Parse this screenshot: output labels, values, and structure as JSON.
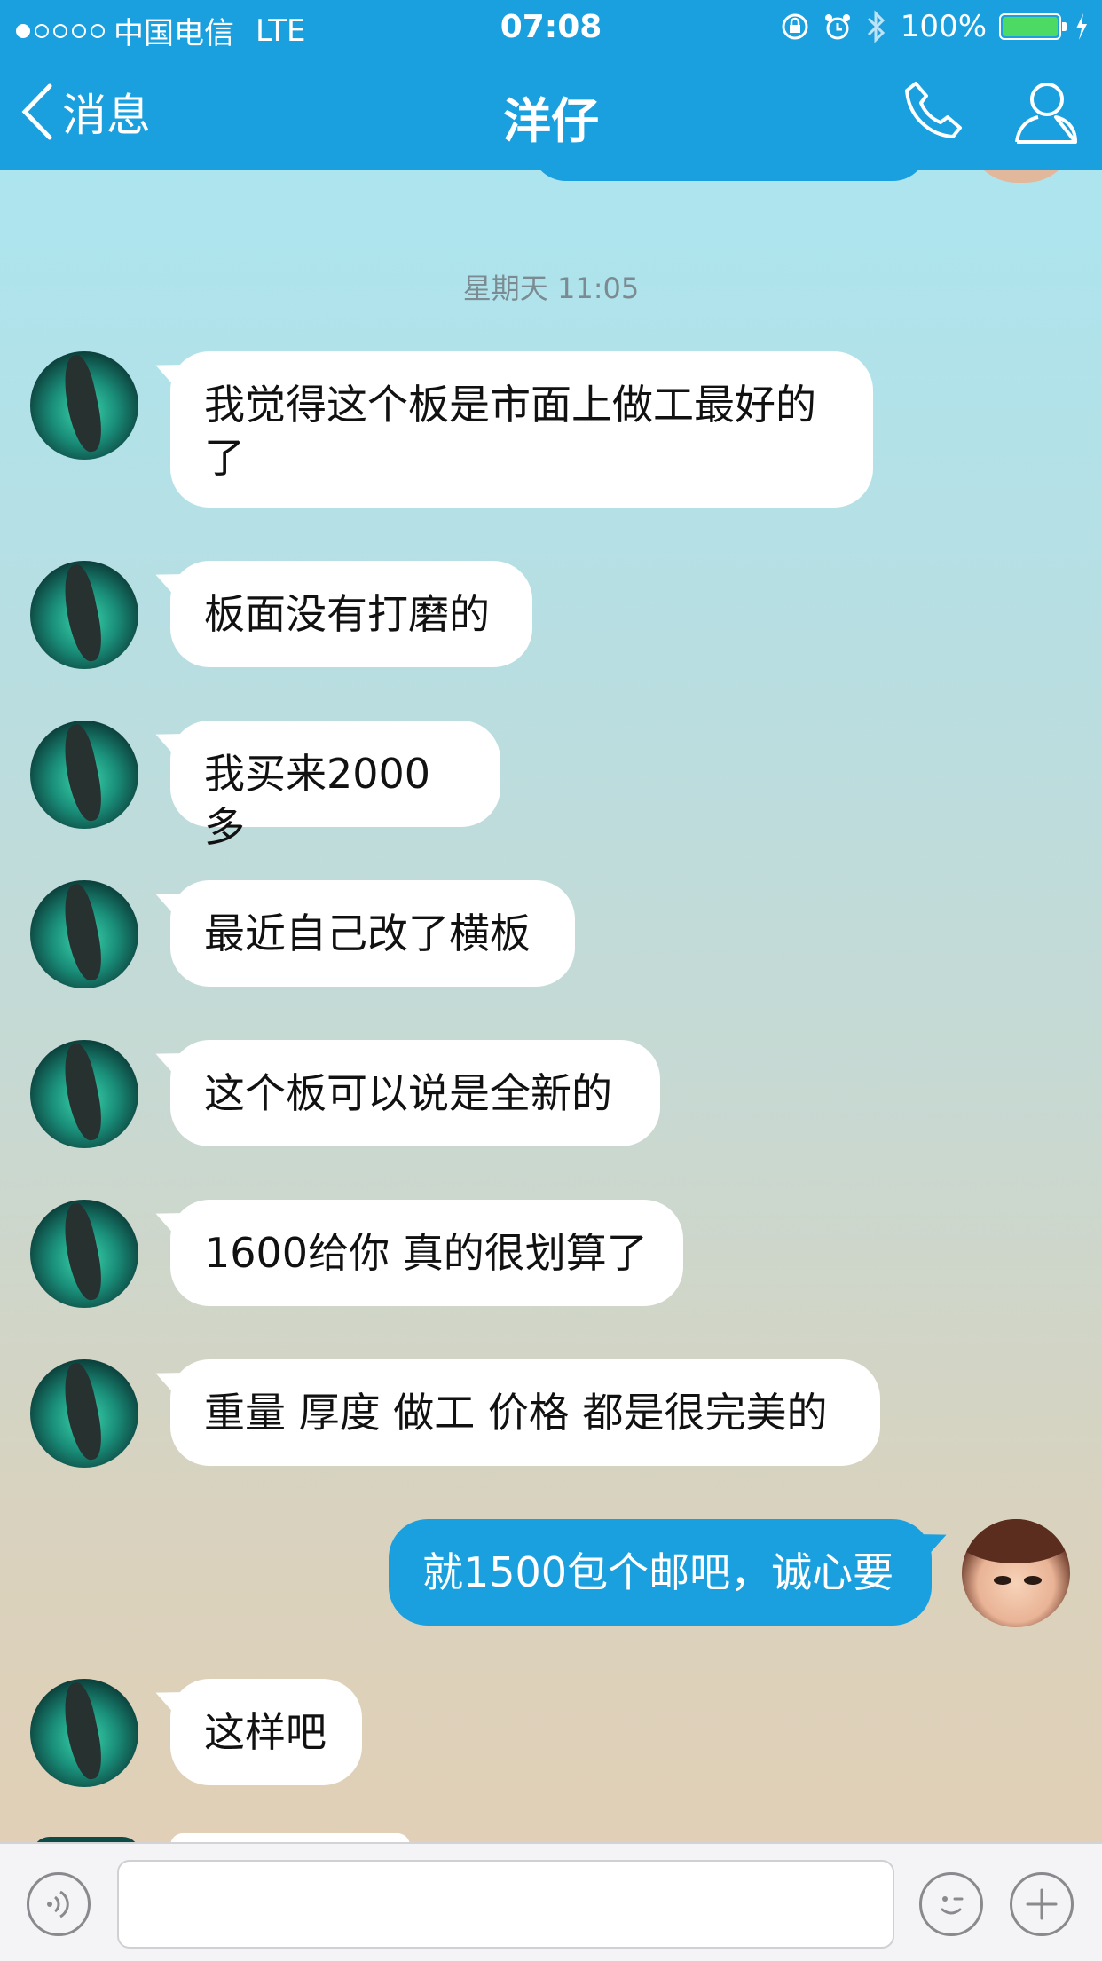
{
  "status_bar": {
    "carrier": "中国电信",
    "network": "LTE",
    "time": "07:08",
    "battery": "100%",
    "battery_level": 1.0
  },
  "nav": {
    "back_label": "消息",
    "title": "洋仔"
  },
  "chat": {
    "timestamp": "星期天 11:05",
    "messages": [
      {
        "from": "other",
        "text": "我觉得这个板是市面上做工最好的了"
      },
      {
        "from": "other",
        "text": "板面没有打磨的"
      },
      {
        "from": "other",
        "text": "我买来2000多"
      },
      {
        "from": "other",
        "text": "最近自己改了横板"
      },
      {
        "from": "other",
        "text": "这个板可以说是全新的"
      },
      {
        "from": "other",
        "text": "1600给你 真的很划算了"
      },
      {
        "from": "other",
        "text": "重量 厚度 做工 价格 都是很完美的"
      },
      {
        "from": "me",
        "text": "就1500包个邮吧，诚心要"
      },
      {
        "from": "other",
        "text": "这样吧"
      }
    ]
  },
  "input_bar": {
    "placeholder": ""
  },
  "colors": {
    "accent": "#1aa0de",
    "battery_green": "#4cd964"
  }
}
